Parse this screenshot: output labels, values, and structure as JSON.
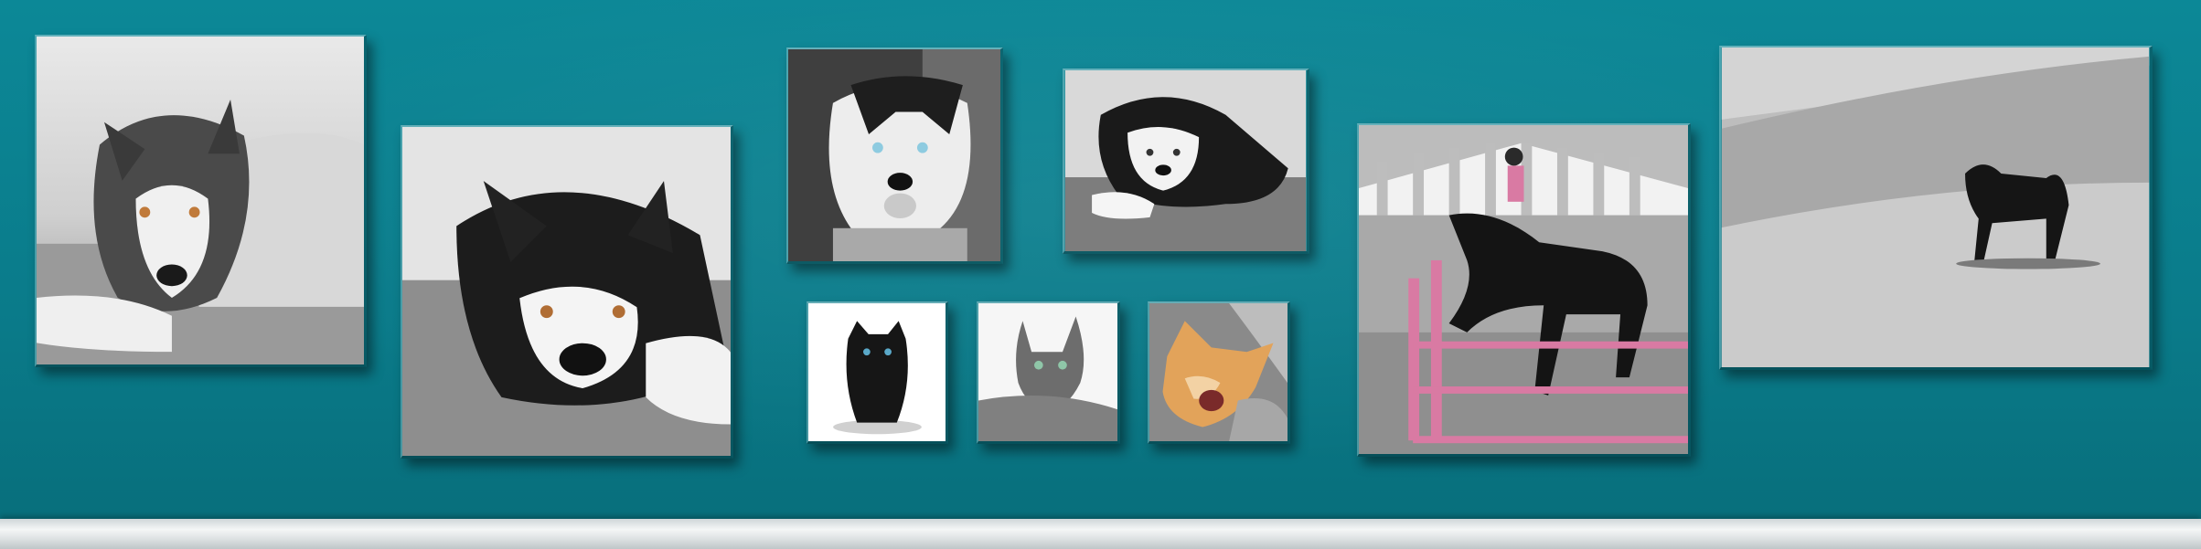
{
  "scene": {
    "description_free": true,
    "wall_color": "#0b7f8e",
    "accent_pink": "#d97aa3"
  },
  "canvases": [
    {
      "id": "husky-lying"
    },
    {
      "id": "malamute-lying"
    },
    {
      "id": "husky-blue-eyes"
    },
    {
      "id": "husky-puppy"
    },
    {
      "id": "black-kitten"
    },
    {
      "id": "gray-cat"
    },
    {
      "id": "orange-kitten"
    },
    {
      "id": "horse-jumper"
    },
    {
      "id": "dog-on-dunes"
    }
  ]
}
